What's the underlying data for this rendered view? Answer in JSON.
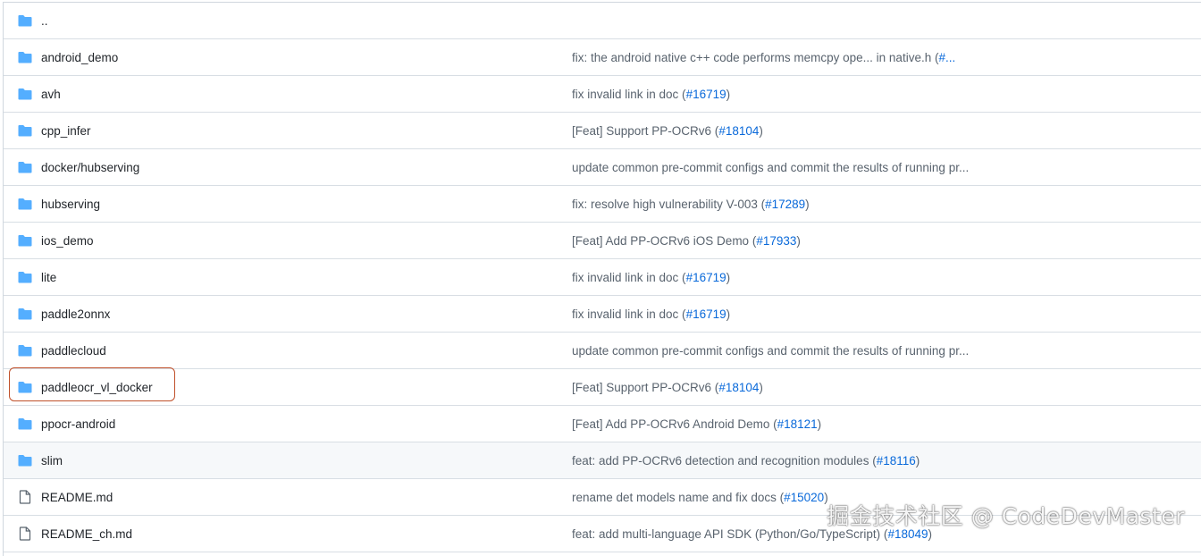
{
  "colors": {
    "folder": "#54aeff",
    "file": "#59636e",
    "link": "#0969da",
    "highlight": "#c0502a"
  },
  "rows": [
    {
      "type": "folder",
      "icon": "folder-icon",
      "name": "..",
      "message": "",
      "pr": ""
    },
    {
      "type": "folder",
      "icon": "folder-icon",
      "name": "android_demo",
      "message": "fix: the android native c++ code performs memcpy ope... in native.h (",
      "pr": "#..."
    },
    {
      "type": "folder",
      "icon": "folder-icon",
      "name": "avh",
      "message": "fix invalid link in doc (",
      "pr": "#16719",
      "close": ")"
    },
    {
      "type": "folder",
      "icon": "folder-icon",
      "name": "cpp_infer",
      "message": "[Feat] Support PP-OCRv6 (",
      "pr": "#18104",
      "close": ")"
    },
    {
      "type": "folder",
      "icon": "folder-icon",
      "name": "docker/hubserving",
      "message": "update common pre-commit configs and commit the results of running pr...",
      "pr": ""
    },
    {
      "type": "folder",
      "icon": "folder-icon",
      "name": "hubserving",
      "message": "fix: resolve high vulnerability V-003 (",
      "pr": "#17289",
      "close": ")"
    },
    {
      "type": "folder",
      "icon": "folder-icon",
      "name": "ios_demo",
      "message": "[Feat] Add PP-OCRv6 iOS Demo (",
      "pr": "#17933",
      "close": ")"
    },
    {
      "type": "folder",
      "icon": "folder-icon",
      "name": "lite",
      "message": "fix invalid link in doc (",
      "pr": "#16719",
      "close": ")"
    },
    {
      "type": "folder",
      "icon": "folder-icon",
      "name": "paddle2onnx",
      "message": "fix invalid link in doc (",
      "pr": "#16719",
      "close": ")"
    },
    {
      "type": "folder",
      "icon": "folder-icon",
      "name": "paddlecloud",
      "message": "update common pre-commit configs and commit the results of running pr...",
      "pr": ""
    },
    {
      "type": "folder",
      "icon": "folder-icon",
      "name": "paddleocr_vl_docker",
      "message": "[Feat] Support PP-OCRv6 (",
      "pr": "#18104",
      "close": ")"
    },
    {
      "type": "folder",
      "icon": "folder-icon",
      "name": "ppocr-android",
      "message": "[Feat] Add PP-OCRv6 Android Demo (",
      "pr": "#18121",
      "close": ")"
    },
    {
      "type": "folder",
      "icon": "folder-icon",
      "name": "slim",
      "message": "feat: add PP-OCRv6 detection and recognition modules (",
      "pr": "#18116",
      "close": ")",
      "hover": true
    },
    {
      "type": "file",
      "icon": "file-icon",
      "name": "README.md",
      "message": "rename det models name and fix docs (",
      "pr": "#15020",
      "close": ")"
    },
    {
      "type": "file",
      "icon": "file-icon",
      "name": "README_ch.md",
      "message": "feat: add multi-language API SDK (Python/Go/TypeScript) (",
      "pr": "#18049",
      "close": ")"
    }
  ],
  "watermark": "掘金技术社区 @ CodeDevMaster"
}
